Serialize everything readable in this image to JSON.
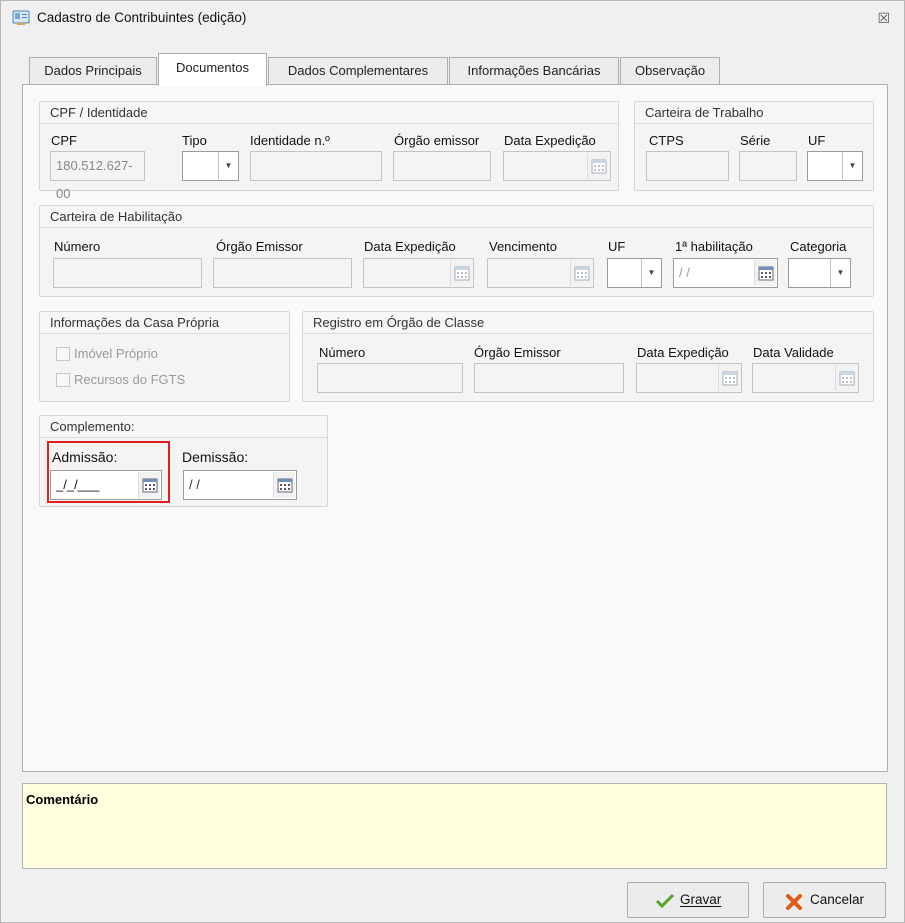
{
  "window": {
    "title": "Cadastro de Contribuintes (edição)",
    "close_glyph": "☒"
  },
  "tabs": [
    {
      "label": "Dados Principais"
    },
    {
      "label": "Documentos"
    },
    {
      "label": "Dados Complementares"
    },
    {
      "label": "Informações Bancárias"
    },
    {
      "label": "Observação"
    }
  ],
  "active_tab": "Documentos",
  "cpf_group": {
    "title": "CPF / Identidade",
    "cpf_label": "CPF",
    "cpf_value": "180.512.627-00",
    "tipo_label": "Tipo",
    "identidade_label": "Identidade n.º",
    "orgao_label": "Órgão emissor",
    "data_exp_label": "Data Expedição"
  },
  "ctps_group": {
    "title": "Carteira de Trabalho",
    "ctps_label": "CTPS",
    "serie_label": "Série",
    "uf_label": "UF"
  },
  "cnh_group": {
    "title": "Carteira de Habilitação",
    "numero_label": "Número",
    "orgao_label": "Órgão Emissor",
    "data_exp_label": "Data Expedição",
    "vencimento_label": "Vencimento",
    "uf_label": "UF",
    "primeira_label": "1ª habilitação",
    "primeira_value": "/ /",
    "categoria_label": "Categoria"
  },
  "casa_group": {
    "title": "Informações da Casa Própria",
    "imovel_label": "Imóvel Próprio",
    "fgts_label": "Recursos do FGTS"
  },
  "classe_group": {
    "title": "Registro em Órgão de Classe",
    "numero_label": "Número",
    "orgao_label": "Órgão Emissor",
    "data_exp_label": "Data Expedição",
    "validade_label": "Data Validade"
  },
  "complemento_group": {
    "title": "Complemento:",
    "admissao_label": "Admissão:",
    "admissao_value": "_/_/___",
    "demissao_label": "Demissão:",
    "demissao_value": "/ /"
  },
  "comment": {
    "title": "Comentário"
  },
  "buttons": {
    "gravar": "Gravar",
    "cancelar": "Cancelar"
  },
  "colors": {
    "highlight": "#e0201b",
    "comment_bg": "#ffffe0",
    "gravar_icon": "#5aa52a",
    "cancelar_icon": "#e05a1a"
  }
}
